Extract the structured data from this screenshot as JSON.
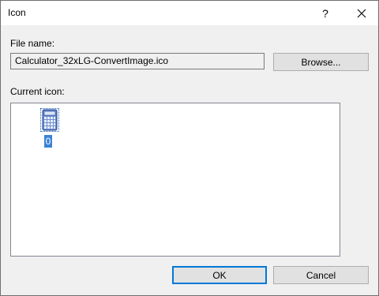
{
  "window": {
    "title": "Icon",
    "help_glyph": "?",
    "close_icon": "close-icon"
  },
  "file": {
    "label": "File name:",
    "value": "Calculator_32xLG-ConvertImage.ico",
    "browse_label": "Browse..."
  },
  "icons": {
    "label": "Current icon:",
    "items": [
      {
        "index": "0",
        "icon": "calculator-icon",
        "selected": true
      }
    ]
  },
  "buttons": {
    "ok_label": "OK",
    "cancel_label": "Cancel"
  },
  "colors": {
    "selection": "#3b82d6",
    "default_button_border": "#0078d7",
    "dialog_background": "#f0f0f0"
  }
}
